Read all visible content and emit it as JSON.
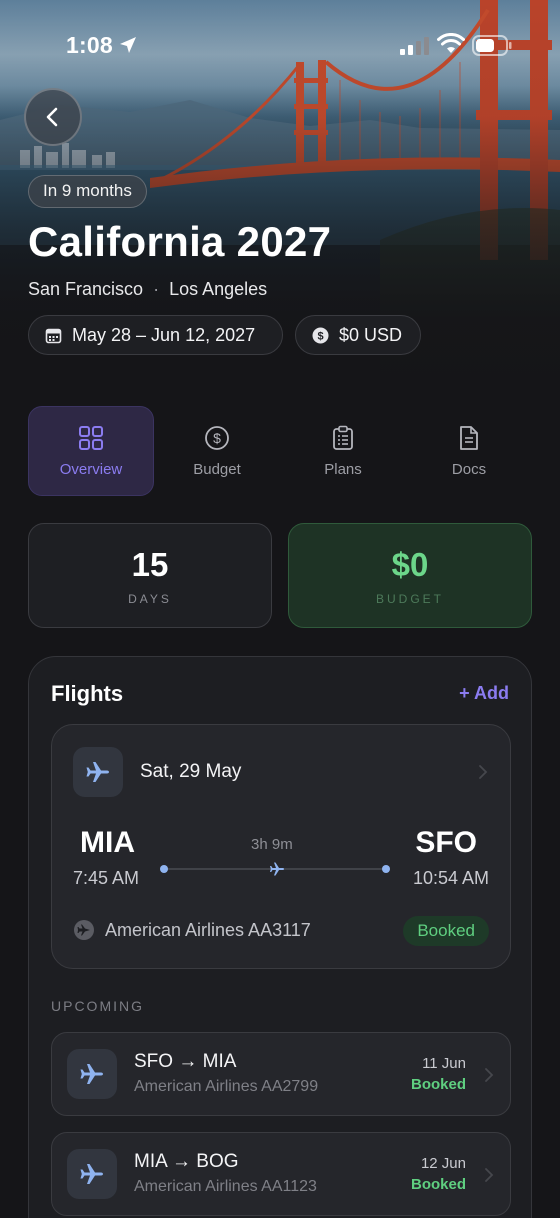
{
  "status_bar": {
    "time": "1:08"
  },
  "trip": {
    "countdown": "In 9 months",
    "title": "California 2027",
    "cities": [
      "San Francisco",
      "Los Angeles"
    ],
    "city_separator": "·",
    "dates": "May 28 – Jun 12, 2027",
    "budget": "$0 USD"
  },
  "tabs": [
    {
      "label": "Overview",
      "icon": "grid-icon",
      "active": true
    },
    {
      "label": "Budget",
      "icon": "dollar-circle-icon",
      "active": false
    },
    {
      "label": "Plans",
      "icon": "clipboard-icon",
      "active": false
    },
    {
      "label": "Docs",
      "icon": "document-icon",
      "active": false
    }
  ],
  "stats": {
    "days": {
      "value": "15",
      "label": "DAYS"
    },
    "budget": {
      "value": "$0",
      "label": "BUDGET"
    }
  },
  "flights": {
    "title": "Flights",
    "add_label": "+ Add",
    "featured": {
      "date": "Sat, 29 May",
      "from_code": "MIA",
      "from_time": "7:45 AM",
      "to_code": "SFO",
      "to_time": "10:54 AM",
      "duration": "3h 9m",
      "airline": "American Airlines AA3117",
      "status": "Booked"
    },
    "upcoming_label": "UPCOMING",
    "upcoming": [
      {
        "route": "SFO → MIA",
        "airline": "American Airlines AA2799",
        "date": "11 Jun",
        "status": "Booked"
      },
      {
        "route": "MIA → BOG",
        "airline": "American Airlines AA1123",
        "date": "12 Jun",
        "status": "Booked"
      }
    ]
  },
  "colors": {
    "accent": "#8b7cf0",
    "success": "#5fcf80",
    "background": "#151518"
  }
}
